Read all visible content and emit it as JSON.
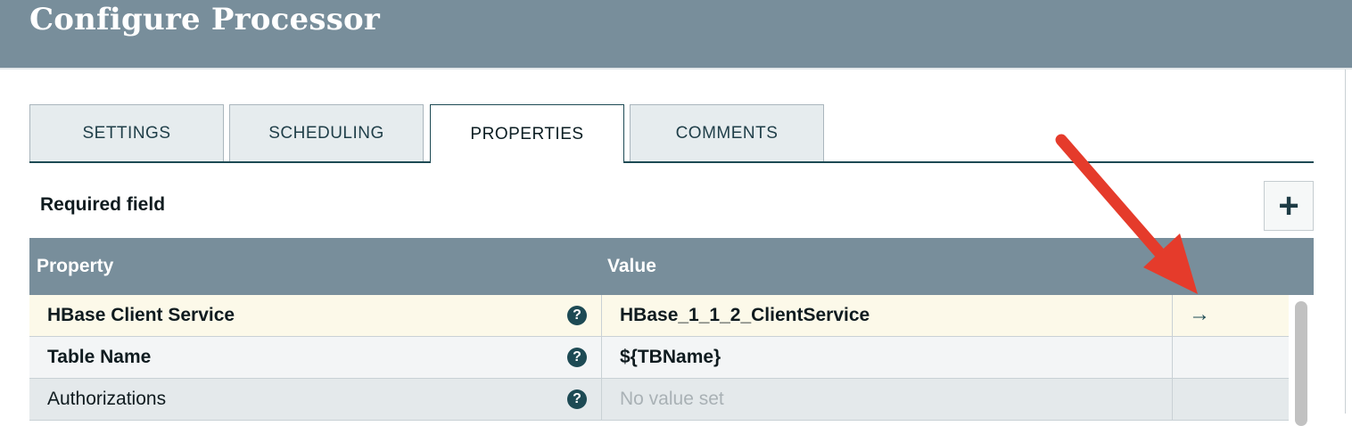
{
  "dialog": {
    "title": "Configure Processor"
  },
  "tabs": [
    {
      "label": "SETTINGS"
    },
    {
      "label": "SCHEDULING"
    },
    {
      "label": "PROPERTIES",
      "active": true
    },
    {
      "label": "COMMENTS"
    }
  ],
  "properties_panel": {
    "required_label": "Required field",
    "add_button_label": "+",
    "columns": {
      "property": "Property",
      "value": "Value"
    },
    "rows": [
      {
        "name": "HBase Client Service",
        "value": "HBase_1_1_2_ClientService",
        "required": true,
        "help": "?",
        "action": "→",
        "highlighted": true
      },
      {
        "name": "Table Name",
        "value": "${TBName}",
        "required": true,
        "help": "?"
      },
      {
        "name": "Authorizations",
        "value": "No value set",
        "required": false,
        "help": "?",
        "empty": true
      }
    ]
  },
  "colors": {
    "header_bg": "#788e9b",
    "accent": "#1d4a54",
    "row_highlight": "#fcf9e9",
    "row_alt": "#f3f5f6",
    "row_optional": "#e4e9eb",
    "annotation_arrow": "#e53b2b"
  },
  "icons": [
    "help-icon",
    "go-to-arrow-icon",
    "add-icon"
  ]
}
